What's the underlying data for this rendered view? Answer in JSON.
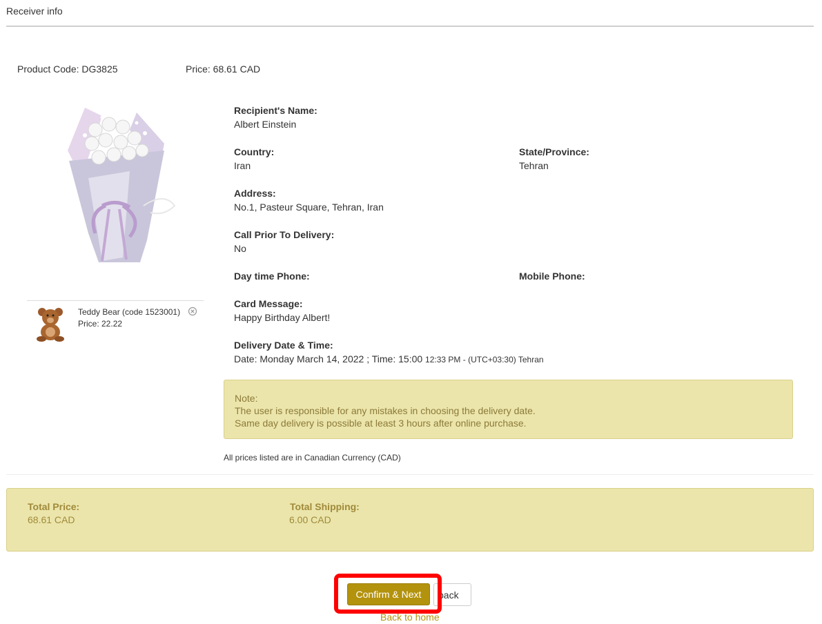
{
  "section_title": "Receiver info",
  "product": {
    "code_text": "Product Code: DG3825",
    "price_text": "Price: 68.61 CAD",
    "image_icon": "white-rose-bouquet-image"
  },
  "addon": {
    "name": "Teddy Bear (code 1523001)",
    "price": "Price: 22.22",
    "icon": "teddy-bear-image",
    "remove_icon": "circle-x-icon"
  },
  "recipient": {
    "name_label": "Recipient's Name:",
    "name_value": "Albert Einstein",
    "country_label": "Country:",
    "country_value": "Iran",
    "state_label": "State/Province:",
    "state_value": "Tehran",
    "address_label": "Address:",
    "address_value": "No.1, Pasteur Square, Tehran, Iran",
    "call_label": "Call Prior To Delivery:",
    "call_value": "No",
    "day_phone_label": "Day time Phone:",
    "mobile_label": "Mobile Phone:",
    "card_label": "Card Message:",
    "card_value": "Happy Birthday Albert!",
    "delivery_label": "Delivery Date & Time:",
    "delivery_value": "Date: Monday March 14, 2022 ; Time: 15:00",
    "delivery_time_small": "12:33 PM - (UTC+03:30) Tehran"
  },
  "note": {
    "title": "Note:",
    "line1": "The user is responsible for any mistakes in choosing the delivery date.",
    "line2": "Same day delivery is possible at least 3 hours after online purchase."
  },
  "currency_note": "All prices listed are in Canadian Currency (CAD)",
  "totals": {
    "price_label": "Total Price:",
    "price_value": "68.61 CAD",
    "shipping_label": "Total Shipping:",
    "shipping_value": "6.00 CAD"
  },
  "actions": {
    "confirm_label": "Confirm & Next",
    "back_label": "back",
    "home_label": "Back to home"
  },
  "colors": {
    "accent": "#b3920e",
    "note_bg": "#ebe5ab",
    "highlight": "#ff0000"
  }
}
